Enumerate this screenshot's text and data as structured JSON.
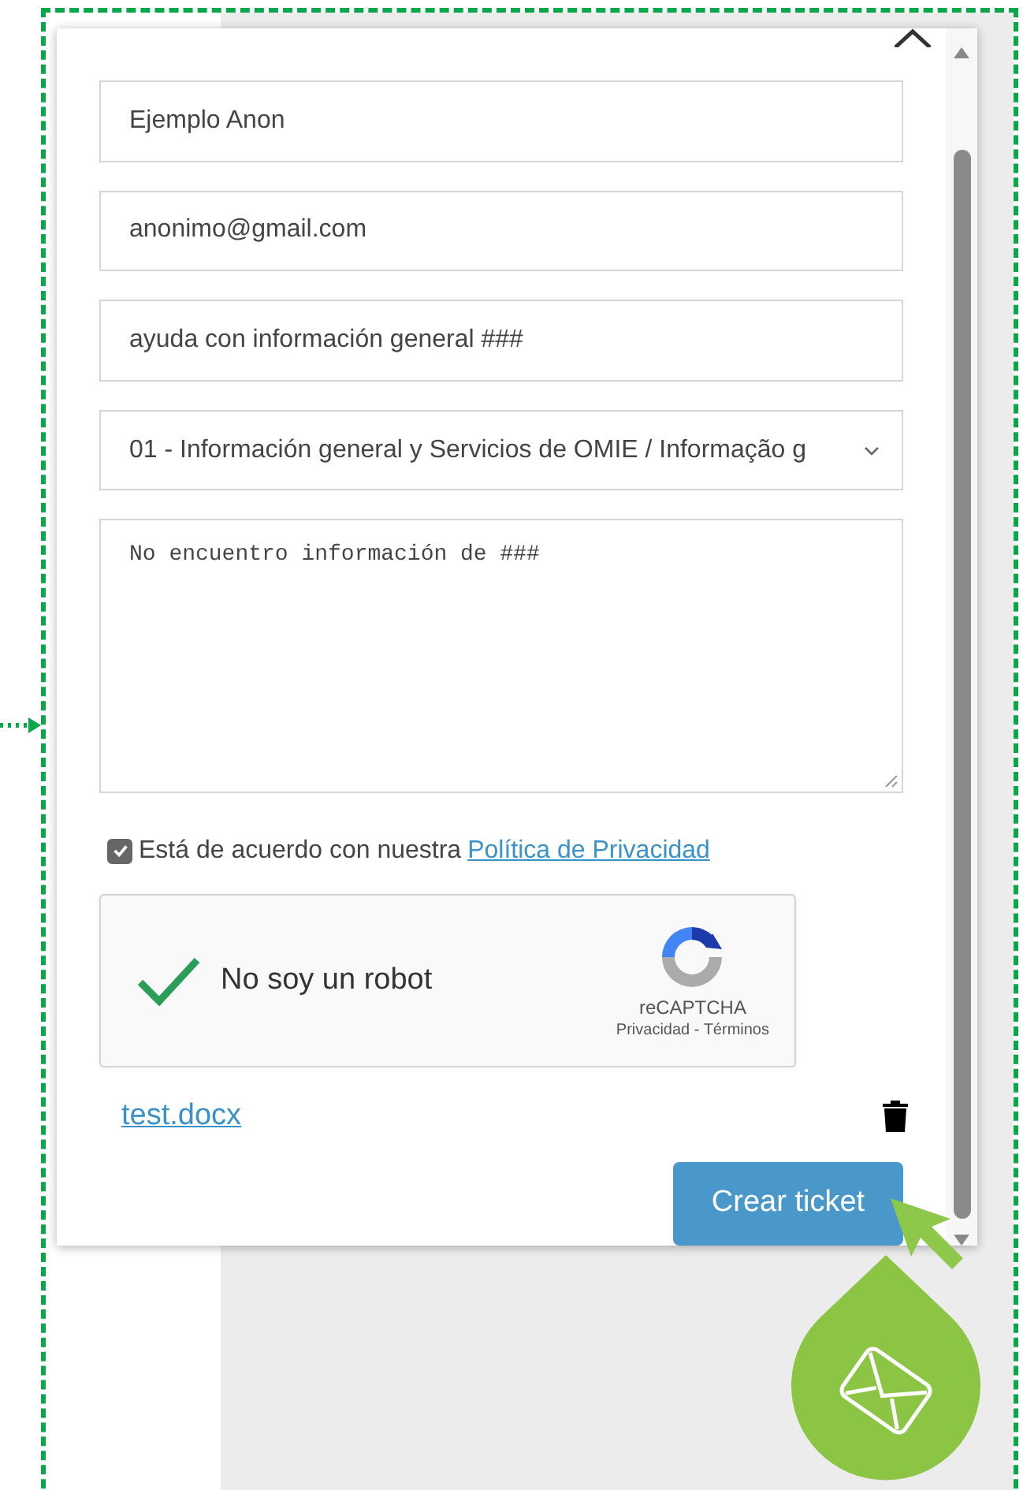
{
  "form": {
    "fields": [
      {
        "kind": "input",
        "value": "Ejemplo Anon"
      },
      {
        "kind": "input",
        "value": "anonimo@gmail.com"
      },
      {
        "kind": "input",
        "value": "ayuda con información general ###"
      },
      {
        "kind": "select",
        "value": "01 - Información general y Servicios de OMIE / Informação g"
      },
      {
        "kind": "textarea",
        "value": "No encuentro información de ###"
      }
    ],
    "consent": {
      "checked": true,
      "text": "Está de acuerdo con nuestra",
      "link": "Política de Privacidad"
    },
    "captcha": {
      "checked": true,
      "label": "No soy un robot",
      "brand": "reCAPTCHA",
      "links": "Privacidad - Términos"
    },
    "attachment": {
      "name": "test.docx"
    },
    "submit": "Crear ticket"
  }
}
